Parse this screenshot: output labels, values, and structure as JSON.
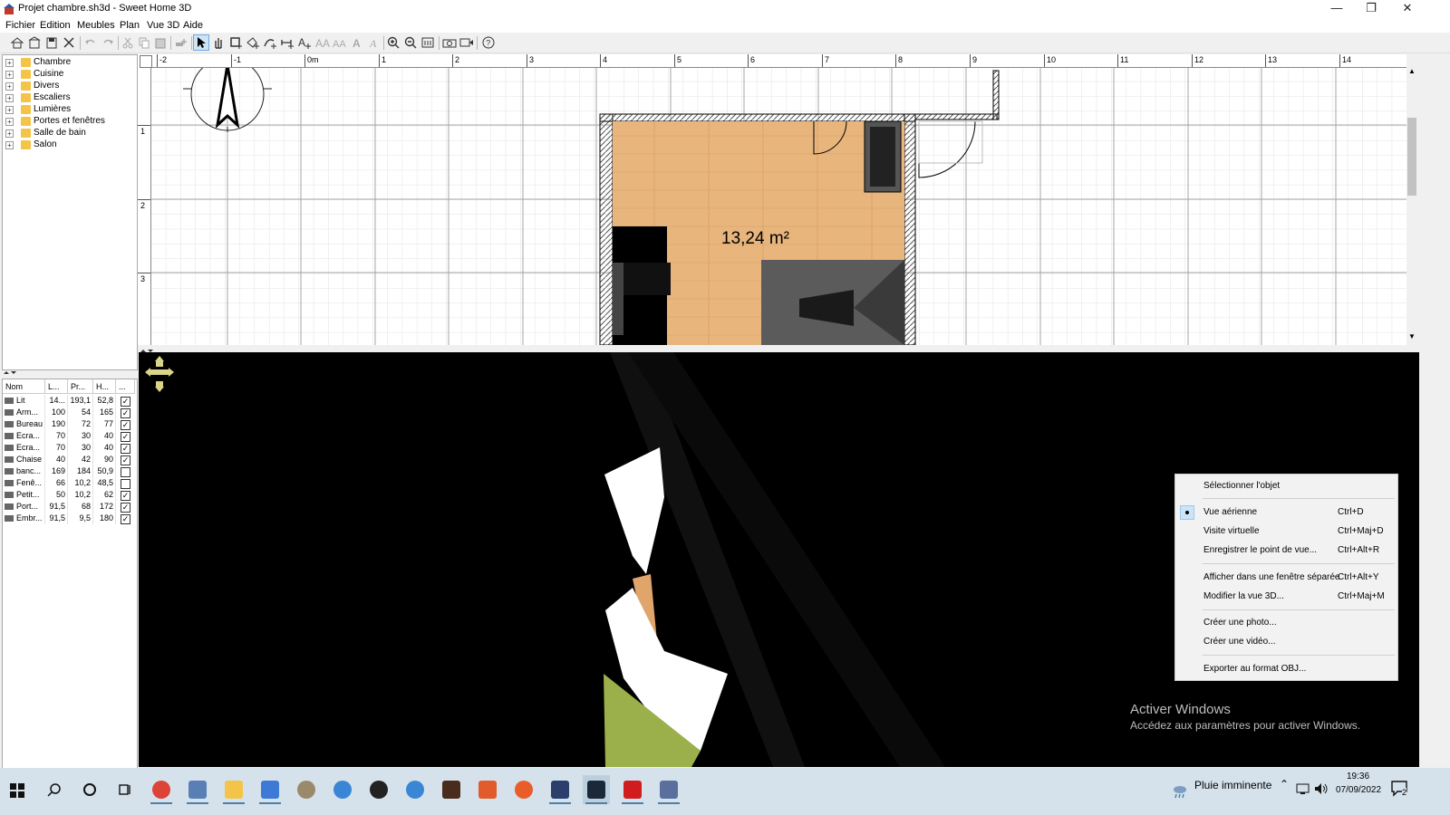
{
  "window": {
    "title": "Projet chambre.sh3d - Sweet Home 3D",
    "controls": [
      "minimize",
      "restore",
      "close"
    ]
  },
  "menubar": [
    "Fichier",
    "Edition",
    "Meubles",
    "Plan",
    "Vue 3D",
    "Aide"
  ],
  "toolbar": {
    "icons": [
      "new-home-icon",
      "open-icon",
      "save-icon",
      "cut-tool-icon",
      "undo-icon",
      "redo-icon",
      "cut-icon",
      "copy-icon",
      "paste-icon",
      "add-furniture-icon",
      "select-icon",
      "pan-icon",
      "create-walls-icon",
      "create-rooms-icon",
      "create-polylines-icon",
      "create-dimensions-icon",
      "create-labels-icon",
      "increase-text-icon",
      "decrease-text-icon",
      "bold-icon",
      "italic-icon",
      "zoom-in-icon",
      "zoom-out-icon",
      "import-furniture-icon",
      "create-photo-icon",
      "create-video-icon",
      "help-icon"
    ],
    "active": "select-icon"
  },
  "catalog": {
    "categories": [
      "Chambre",
      "Cuisine",
      "Divers",
      "Escaliers",
      "Lumières",
      "Portes et fenêtres",
      "Salle de bain",
      "Salon"
    ]
  },
  "furniture": {
    "headers": [
      "Nom",
      "L...",
      "Pr...",
      "H...",
      "..."
    ],
    "rows": [
      {
        "name": "Lit",
        "w": "14...",
        "d": "193,1",
        "h": "52,8",
        "visible": true
      },
      {
        "name": "Arm...",
        "w": "100",
        "d": "54",
        "h": "165",
        "visible": true
      },
      {
        "name": "Bureau",
        "w": "190",
        "d": "72",
        "h": "77",
        "visible": true
      },
      {
        "name": "Ecra...",
        "w": "70",
        "d": "30",
        "h": "40",
        "visible": true
      },
      {
        "name": "Ecra...",
        "w": "70",
        "d": "30",
        "h": "40",
        "visible": true
      },
      {
        "name": "Chaise",
        "w": "40",
        "d": "42",
        "h": "90",
        "visible": true
      },
      {
        "name": "banc...",
        "w": "169",
        "d": "184",
        "h": "50,9",
        "visible": false
      },
      {
        "name": "Fenê...",
        "w": "66",
        "d": "10,2",
        "h": "48,5",
        "visible": false
      },
      {
        "name": "Petit...",
        "w": "50",
        "d": "10,2",
        "h": "62",
        "visible": true
      },
      {
        "name": "Port...",
        "w": "91,5",
        "d": "68",
        "h": "172",
        "visible": true
      },
      {
        "name": "Embr...",
        "w": "91,5",
        "d": "9,5",
        "h": "180",
        "visible": true
      }
    ]
  },
  "plan": {
    "ruler_h": [
      "-2",
      "-1",
      "0m",
      "1",
      "2",
      "3",
      "4",
      "5",
      "6",
      "7",
      "8",
      "9",
      "10",
      "11",
      "12",
      "13",
      "14"
    ],
    "ruler_v": [
      "1",
      "2",
      "3"
    ],
    "room_area": "13,24 m²"
  },
  "context_menu": {
    "items": [
      {
        "label": "Sélectionner l'objet",
        "shortcut": "",
        "checked": false
      },
      {
        "label": "Vue aérienne",
        "shortcut": "Ctrl+D",
        "checked": true
      },
      {
        "label": "Visite virtuelle",
        "shortcut": "Ctrl+Maj+D",
        "checked": false
      },
      {
        "label": "Enregistrer le point de vue...",
        "shortcut": "Ctrl+Alt+R",
        "checked": false
      },
      {
        "label": "Afficher dans une fenêtre séparée",
        "shortcut": "Ctrl+Alt+Y",
        "checked": false
      },
      {
        "label": "Modifier la vue 3D...",
        "shortcut": "Ctrl+Maj+M",
        "checked": false
      },
      {
        "label": "Créer une photo...",
        "shortcut": "",
        "checked": false
      },
      {
        "label": "Créer une vidéo...",
        "shortcut": "",
        "checked": false
      },
      {
        "label": "Exporter au format OBJ...",
        "shortcut": "",
        "checked": false
      }
    ]
  },
  "watermark": {
    "line1": "Activer Windows",
    "line2": "Accédez aux paramètres pour activer Windows."
  },
  "taskbar": {
    "apps": [
      "chrome-icon",
      "photos-icon",
      "file-explorer-icon",
      "app-icon",
      "gimp-icon",
      "app-icon",
      "steam-icon",
      "app-icon",
      "app-icon",
      "app-icon",
      "opera-icon",
      "photoshop-icon",
      "steam-icon",
      "app-icon",
      "sweet-home-3d-icon"
    ],
    "weather": "Pluie imminente",
    "time": "19:36",
    "date": "07/09/2022",
    "notifications": "2"
  }
}
